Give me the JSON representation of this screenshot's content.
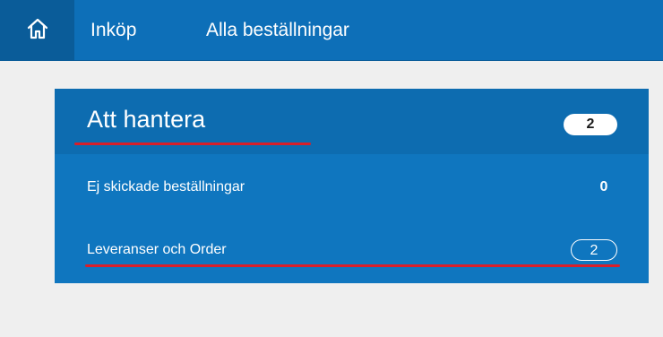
{
  "nav": {
    "home_icon": "home-icon",
    "items": [
      {
        "label": "Inköp"
      },
      {
        "label": "Alla beställningar"
      }
    ]
  },
  "card": {
    "title": "Att hantera",
    "badge": "2",
    "rows": [
      {
        "label": "Ej skickade beställningar",
        "count": "0"
      },
      {
        "label": "Leveranser och Order",
        "count": "2"
      }
    ]
  },
  "colors": {
    "topbar": "#0d6fb8",
    "home": "#0a5c99",
    "card": "#0f76bf",
    "card_header": "#0d6cb0",
    "underline": "#d91f2a",
    "background": "#efefef"
  }
}
